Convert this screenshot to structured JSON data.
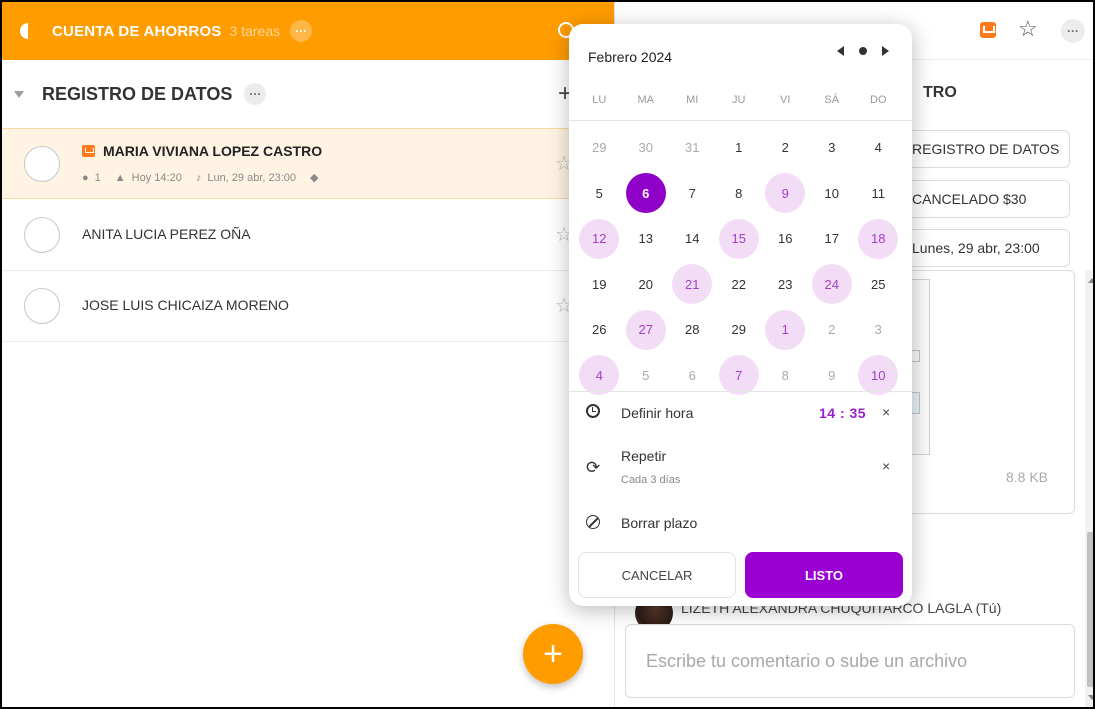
{
  "list": {
    "title": "CUENTA DE AHORROS",
    "count": "3 tareas",
    "more": "···"
  },
  "section": {
    "title": "REGISTRO DE DATOS",
    "more": "···",
    "add": "+"
  },
  "tasks": [
    {
      "name": "MARIA VIVIANA LOPEZ CASTRO",
      "comments": "1",
      "start": "Hoy 14:20",
      "reminder": "Lun, 29 abr, 23:00",
      "selected": true
    },
    {
      "name": "ANITA LUCIA PEREZ OÑA"
    },
    {
      "name": "JOSE LUIS CHICAIZA MORENO"
    }
  ],
  "fab": "+",
  "detail": {
    "title": "TRO",
    "fields": [
      "REGISTRO DE DATOS",
      "CANCELADO $30",
      "Lunes, 29 abr, 23:00"
    ],
    "attachment_size": "8.8 KB",
    "author": "LIZETH ALEXANDRA CHUQUITARCO LAGLA (Tú)",
    "comment_placeholder": "Escribe tu comentario o sube un archivo",
    "more": "···"
  },
  "picker": {
    "month": "Febrero 2024",
    "weekdays": [
      "LU",
      "MA",
      "MI",
      "JU",
      "VI",
      "SÁ",
      "DO"
    ],
    "days": [
      {
        "d": "29",
        "t": "muted"
      },
      {
        "d": "30",
        "t": "muted"
      },
      {
        "d": "31",
        "t": "muted"
      },
      {
        "d": "1",
        "t": ""
      },
      {
        "d": "2",
        "t": ""
      },
      {
        "d": "3",
        "t": ""
      },
      {
        "d": "4",
        "t": ""
      },
      {
        "d": "5",
        "t": ""
      },
      {
        "d": "6",
        "t": "sel"
      },
      {
        "d": "7",
        "t": ""
      },
      {
        "d": "8",
        "t": ""
      },
      {
        "d": "9",
        "t": "hl"
      },
      {
        "d": "10",
        "t": ""
      },
      {
        "d": "11",
        "t": ""
      },
      {
        "d": "12",
        "t": "hl"
      },
      {
        "d": "13",
        "t": ""
      },
      {
        "d": "14",
        "t": ""
      },
      {
        "d": "15",
        "t": "hl"
      },
      {
        "d": "16",
        "t": ""
      },
      {
        "d": "17",
        "t": ""
      },
      {
        "d": "18",
        "t": "hl"
      },
      {
        "d": "19",
        "t": ""
      },
      {
        "d": "20",
        "t": ""
      },
      {
        "d": "21",
        "t": "hl"
      },
      {
        "d": "22",
        "t": ""
      },
      {
        "d": "23",
        "t": ""
      },
      {
        "d": "24",
        "t": "hl"
      },
      {
        "d": "25",
        "t": ""
      },
      {
        "d": "26",
        "t": ""
      },
      {
        "d": "27",
        "t": "hl"
      },
      {
        "d": "28",
        "t": ""
      },
      {
        "d": "29",
        "t": ""
      },
      {
        "d": "1",
        "t": "hl"
      },
      {
        "d": "2",
        "t": "muted"
      },
      {
        "d": "3",
        "t": "muted"
      },
      {
        "d": "4",
        "t": "hl"
      },
      {
        "d": "5",
        "t": "muted"
      },
      {
        "d": "6",
        "t": "muted"
      },
      {
        "d": "7",
        "t": "hl"
      },
      {
        "d": "8",
        "t": "muted"
      },
      {
        "d": "9",
        "t": "muted"
      },
      {
        "d": "10",
        "t": "hl"
      }
    ],
    "set_time_label": "Definir hora",
    "time": "14 : 35",
    "repeat_label": "Repetir",
    "repeat_sub": "Cada 3 días",
    "clear_label": "Borrar plazo",
    "cancel": "CANCELAR",
    "done": "LISTO",
    "clear_x": "×"
  },
  "colors": {
    "accent": "#ff9c00",
    "picker_selected": "#8f00c9",
    "picker_highlight": "#f3dcf6",
    "done_button": "#9b00d3"
  }
}
